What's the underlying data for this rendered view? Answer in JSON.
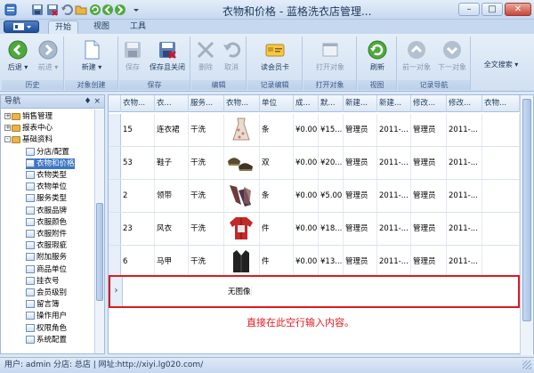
{
  "window": {
    "title": "衣物和价格 - 蓝格洗衣店管理..."
  },
  "tabs": [
    {
      "label": "开始"
    },
    {
      "label": "视图"
    },
    {
      "label": "工具"
    }
  ],
  "ribbon": {
    "groups": [
      {
        "label": "历史",
        "buttons": [
          {
            "label": "后退"
          },
          {
            "label": "前进"
          }
        ]
      },
      {
        "label": "对象创建",
        "buttons": [
          {
            "label": "新建"
          }
        ]
      },
      {
        "label": "保存",
        "buttons": [
          {
            "label": "保存"
          },
          {
            "label": "保存且关闭"
          }
        ]
      },
      {
        "label": "编辑",
        "buttons": [
          {
            "label": "删除"
          },
          {
            "label": "取消"
          }
        ]
      },
      {
        "label": "记录编辑",
        "buttons": [
          {
            "label": "读会员卡"
          }
        ]
      },
      {
        "label": "打开对象",
        "buttons": [
          {
            "label": "打开对象"
          }
        ]
      },
      {
        "label": "视图",
        "buttons": [
          {
            "label": "刷新"
          }
        ]
      },
      {
        "label": "记录导航",
        "buttons": [
          {
            "label": "前一对象"
          },
          {
            "label": "下一对象"
          }
        ]
      },
      {
        "label": "",
        "buttons": [
          {
            "label": "全文搜索"
          }
        ]
      }
    ]
  },
  "sidebar": {
    "title": "导航",
    "pin": "♦ ×",
    "tree": [
      {
        "label": "销售管理",
        "level": 0,
        "type": "folder",
        "expander": "+"
      },
      {
        "label": "报表中心",
        "level": 0,
        "type": "folder",
        "expander": "+"
      },
      {
        "label": "基础资料",
        "level": 0,
        "type": "folder",
        "expander": "-"
      },
      {
        "label": "分店/配置",
        "level": 1,
        "type": "leaf"
      },
      {
        "label": "衣物和价格",
        "level": 1,
        "type": "leaf",
        "selected": true
      },
      {
        "label": "衣物类型",
        "level": 1,
        "type": "leaf"
      },
      {
        "label": "衣物单位",
        "level": 1,
        "type": "leaf"
      },
      {
        "label": "服务类型",
        "level": 1,
        "type": "leaf"
      },
      {
        "label": "衣服品牌",
        "level": 1,
        "type": "leaf"
      },
      {
        "label": "衣服颜色",
        "level": 1,
        "type": "leaf"
      },
      {
        "label": "衣服附件",
        "level": 1,
        "type": "leaf"
      },
      {
        "label": "衣服瑕疵",
        "level": 1,
        "type": "leaf"
      },
      {
        "label": "附加服务",
        "level": 1,
        "type": "leaf"
      },
      {
        "label": "商品单位",
        "level": 1,
        "type": "leaf"
      },
      {
        "label": "挂衣号",
        "level": 1,
        "type": "leaf"
      },
      {
        "label": "会员级别",
        "level": 1,
        "type": "leaf"
      },
      {
        "label": "留言簿",
        "level": 1,
        "type": "leaf"
      },
      {
        "label": "操作用户",
        "level": 1,
        "type": "leaf"
      },
      {
        "label": "权限角色",
        "level": 1,
        "type": "leaf"
      },
      {
        "label": "系统配置",
        "level": 1,
        "type": "leaf"
      }
    ]
  },
  "grid": {
    "columns": [
      "衣物...",
      "衣...",
      "服务...",
      "衣物...",
      "单位",
      "成...",
      "默...",
      "新建...",
      "新建...",
      "修改...",
      "修改...",
      "衣物..."
    ],
    "rows": [
      {
        "cells": [
          "15",
          "连衣裙",
          "干洗",
          "",
          "条",
          "¥0.00",
          "¥15...",
          "管理员",
          "2011-...",
          "管理员",
          "2011-...",
          ""
        ],
        "image": "dress"
      },
      {
        "cells": [
          "53",
          "鞋子",
          "干洗",
          "",
          "双",
          "¥0.00",
          "¥20...",
          "管理员",
          "2011-...",
          "管理员",
          "2011-...",
          ""
        ],
        "image": "shoes"
      },
      {
        "cells": [
          "2",
          "领带",
          "干洗",
          "",
          "条",
          "¥0.00",
          "¥5.00",
          "管理员",
          "2011-...",
          "管理员",
          "2011-...",
          ""
        ],
        "image": "ties"
      },
      {
        "cells": [
          "23",
          "风衣",
          "干洗",
          "",
          "件",
          "¥0.00",
          "¥18...",
          "管理员",
          "2011-...",
          "管理员",
          "2011-...",
          ""
        ],
        "image": "coat"
      },
      {
        "cells": [
          "6",
          "马甲",
          "干洗",
          "",
          "件",
          "¥0.00",
          "¥13...",
          "管理员",
          "2011-...",
          "管理员",
          "2011-...",
          ""
        ],
        "image": "vest"
      }
    ],
    "new_row": {
      "indicator": "›",
      "image_text": "无图像"
    },
    "hint": "直接在此空行输入内容。"
  },
  "status": {
    "text": "用户: admin  分店: 总店  |  网址:http://xiyi.lg020.com/"
  },
  "colors": {
    "accent": "#3d75c4",
    "highlight": "#e0191e"
  }
}
